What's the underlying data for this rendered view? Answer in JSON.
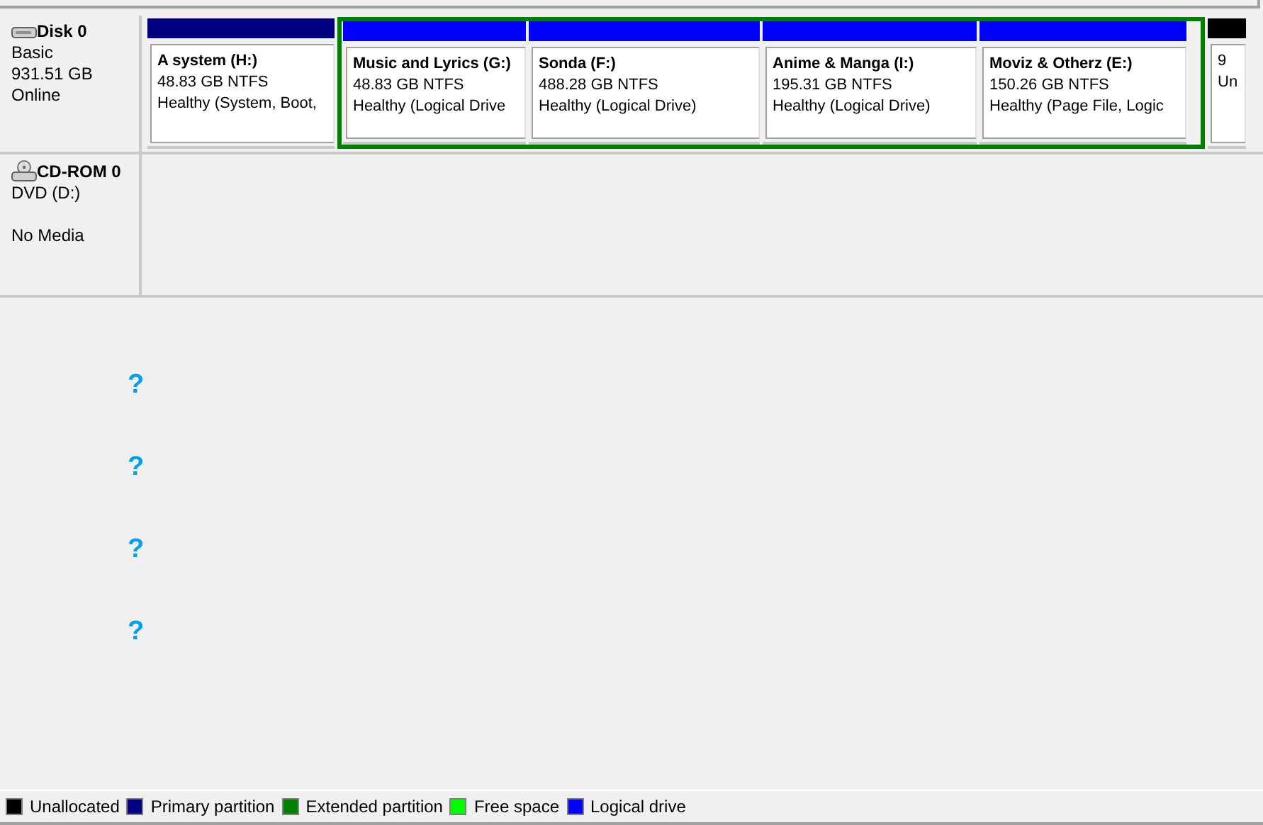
{
  "disks": [
    {
      "kind": "disk",
      "name": "Disk 0",
      "lines": [
        "Basic",
        "931.51 GB",
        "Online"
      ],
      "partitions": [
        {
          "kind": "primary",
          "title": "A system  (H:)",
          "lines": [
            "48.83 GB NTFS",
            "Healthy (System, Boot,"
          ]
        },
        {
          "kind": "extended",
          "children": [
            {
              "kind": "logical",
              "title": "Music and Lyrics  (G:)",
              "lines": [
                "48.83 GB NTFS",
                "Healthy (Logical Drive"
              ]
            },
            {
              "kind": "logical",
              "title": "Sonda  (F:)",
              "lines": [
                "488.28 GB NTFS",
                "Healthy (Logical Drive)"
              ]
            },
            {
              "kind": "logical",
              "title": "Anime & Manga  (I:)",
              "lines": [
                "195.31 GB NTFS",
                "Healthy (Logical Drive)"
              ]
            },
            {
              "kind": "logical",
              "title": "Moviz & Otherz  (E:)",
              "lines": [
                "150.26 GB NTFS",
                "Healthy (Page File, Logic"
              ]
            }
          ]
        },
        {
          "kind": "unallocated",
          "lines": [
            "9",
            "Un"
          ]
        }
      ]
    },
    {
      "kind": "cdrom",
      "name": "CD-ROM 0",
      "lines": [
        "DVD (D:)"
      ],
      "status": "No Media"
    }
  ],
  "unknown_marks": [
    "?",
    "?",
    "?",
    "?"
  ],
  "legend": [
    {
      "label": "Unallocated",
      "color": "#000000"
    },
    {
      "label": "Primary partition",
      "color": "#000080"
    },
    {
      "label": "Extended partition",
      "color": "#008000"
    },
    {
      "label": "Free space",
      "color": "#00ff00"
    },
    {
      "label": "Logical drive",
      "color": "#0000ff"
    }
  ]
}
